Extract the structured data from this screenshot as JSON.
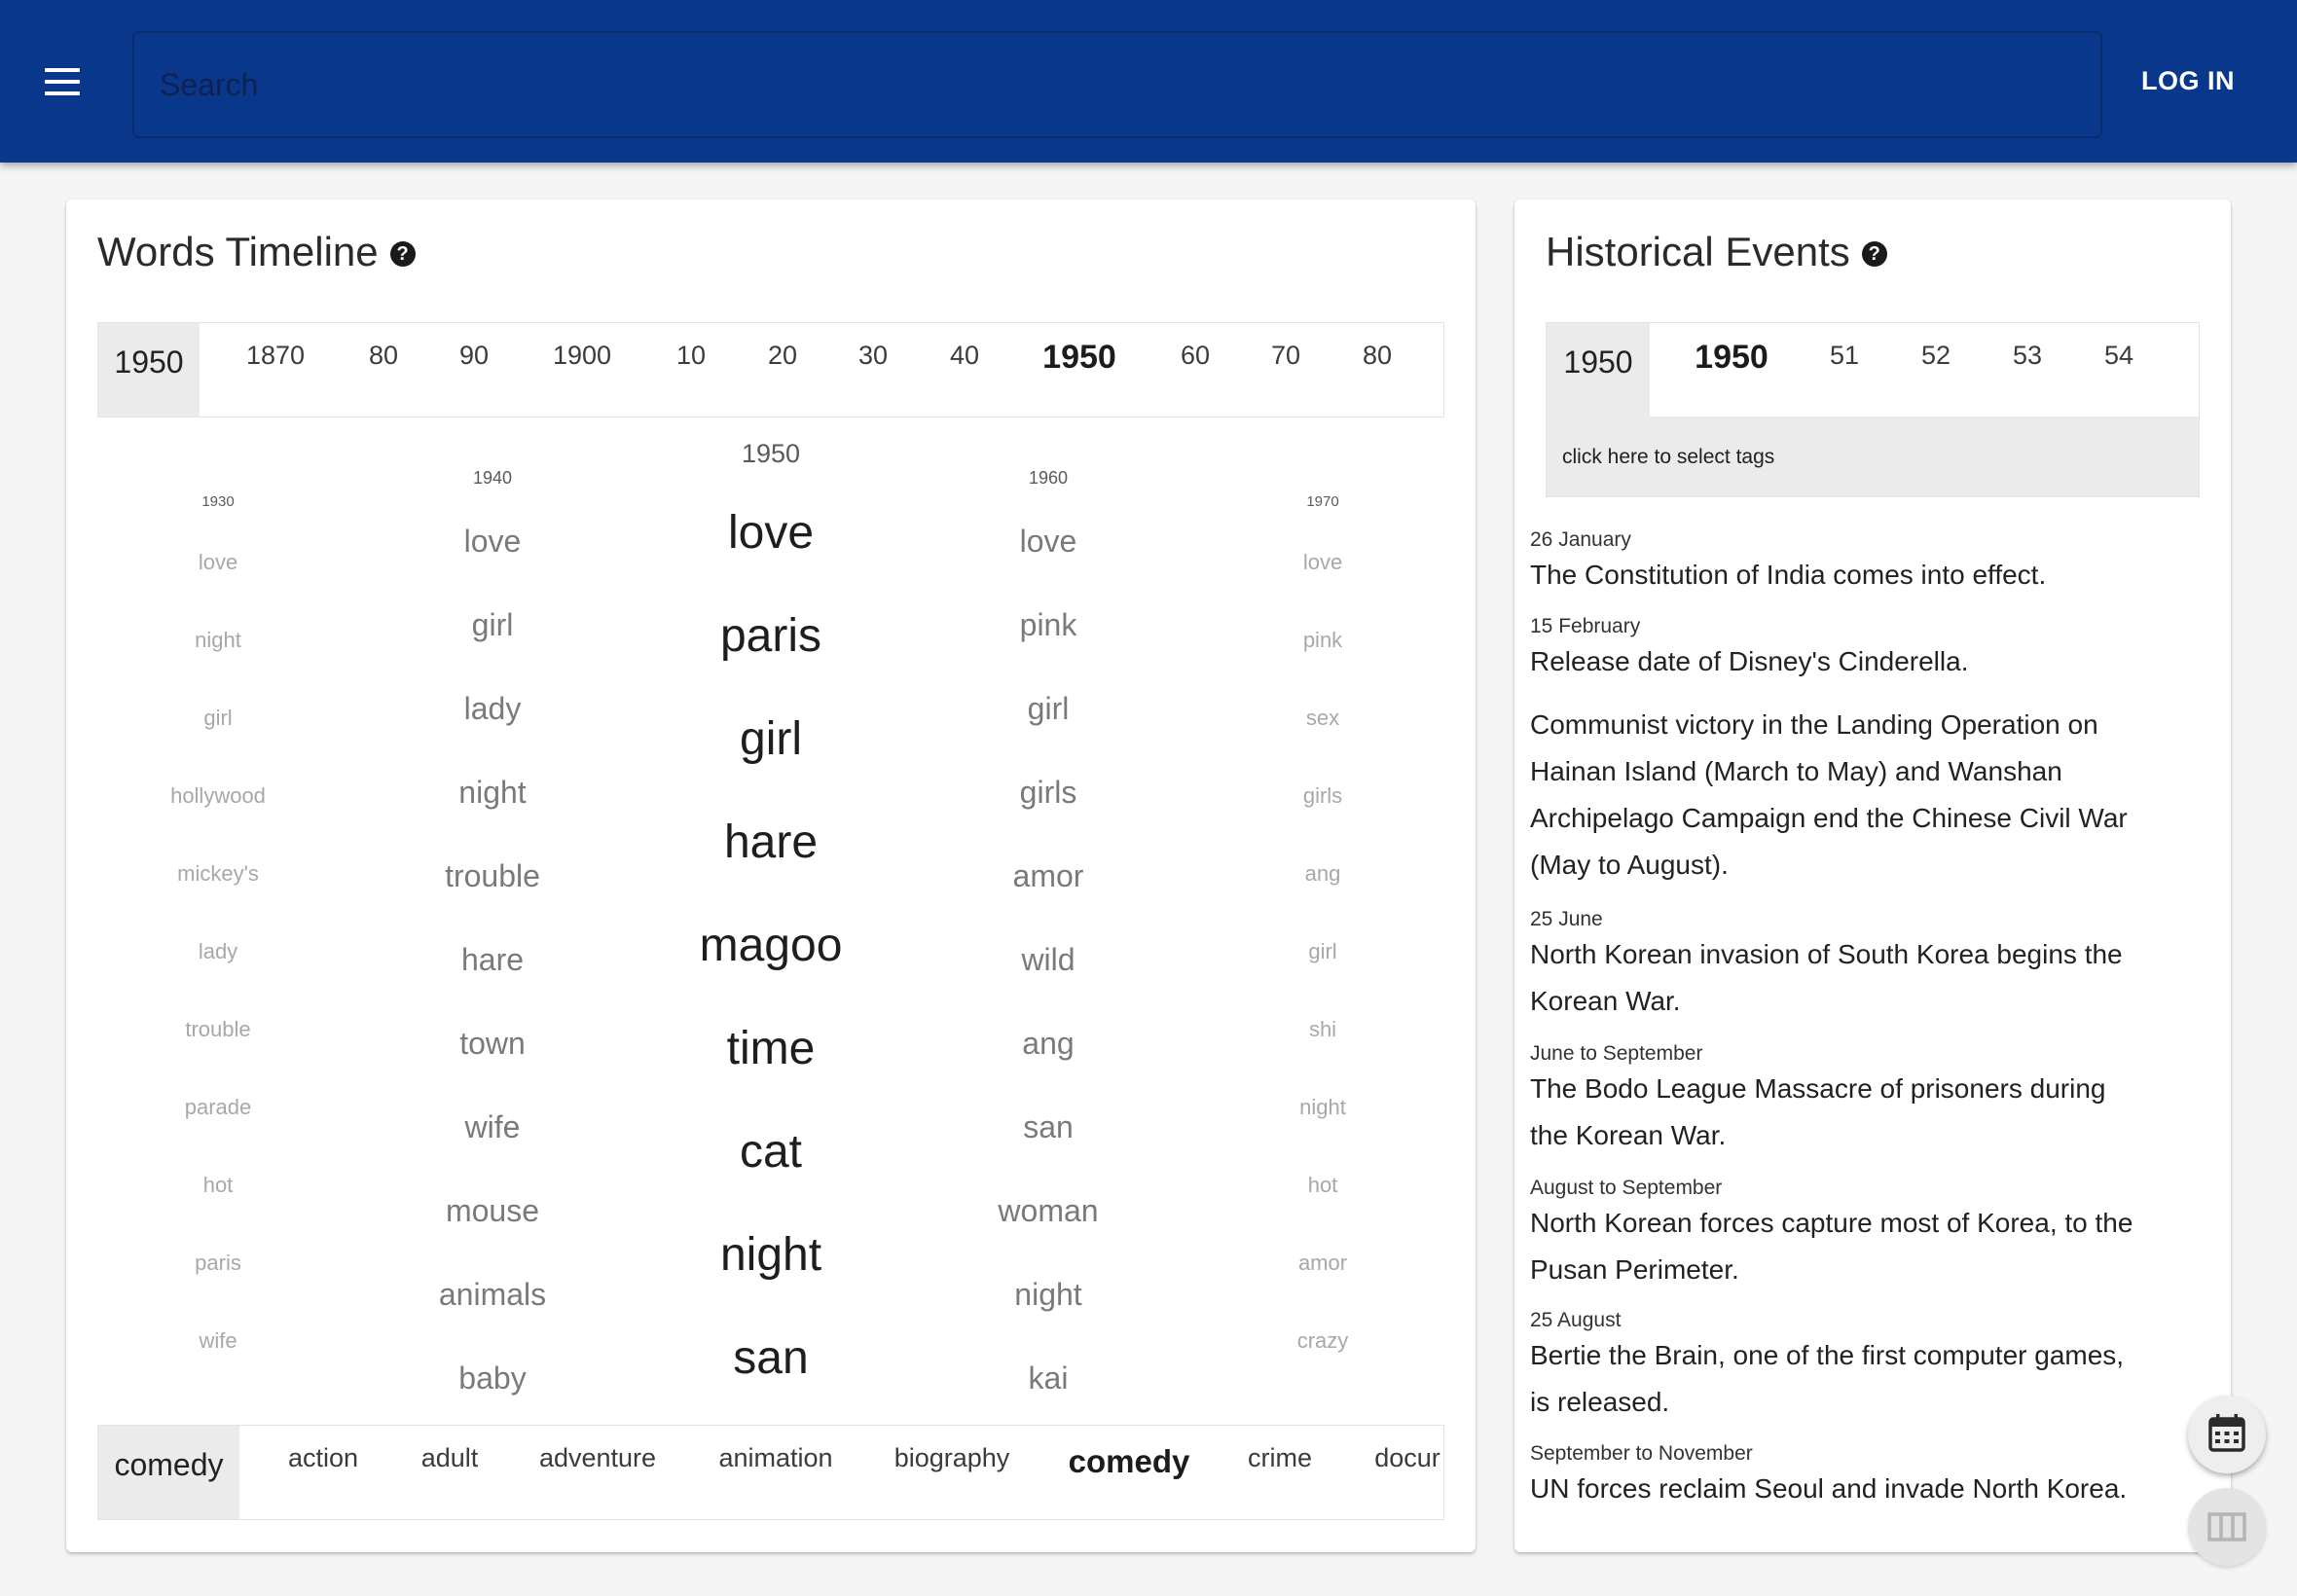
{
  "header": {
    "search_placeholder": "Search",
    "login_label": "LOG IN",
    "menu_icon": "hamburger-menu-icon",
    "bar_color": "#08378c"
  },
  "words_timeline": {
    "title": "Words Timeline",
    "help_icon": "question-circle-icon",
    "decade_selector": {
      "current": "1950",
      "options": [
        "1870",
        "80",
        "90",
        "1900",
        "10",
        "20",
        "30",
        "40",
        "1950",
        "60",
        "70",
        "80"
      ],
      "selected": "1950"
    },
    "columns": [
      {
        "year": "1930",
        "words": [
          "love",
          "night",
          "girl",
          "hollywood",
          "mickey's",
          "lady",
          "trouble",
          "parade",
          "hot",
          "paris",
          "wife"
        ]
      },
      {
        "year": "1940",
        "words": [
          "love",
          "girl",
          "lady",
          "night",
          "trouble",
          "hare",
          "town",
          "wife",
          "mouse",
          "animals",
          "baby"
        ]
      },
      {
        "year": "1950",
        "words": [
          "love",
          "paris",
          "girl",
          "hare",
          "magoo",
          "time",
          "cat",
          "night",
          "san"
        ]
      },
      {
        "year": "1960",
        "words": [
          "love",
          "pink",
          "girl",
          "girls",
          "amor",
          "wild",
          "ang",
          "san",
          "woman",
          "night",
          "kai"
        ]
      },
      {
        "year": "1970",
        "words": [
          "love",
          "pink",
          "sex",
          "girls",
          "ang",
          "girl",
          "shi",
          "night",
          "hot",
          "amor",
          "crazy"
        ]
      }
    ],
    "genre_selector": {
      "current": "comedy",
      "options": [
        "action",
        "adult",
        "adventure",
        "animation",
        "biography",
        "comedy",
        "crime",
        "docur"
      ],
      "selected": "comedy"
    }
  },
  "historical_events": {
    "title": "Historical Events",
    "help_icon": "question-circle-icon",
    "year_selector": {
      "current": "1950",
      "options": [
        "1950",
        "51",
        "52",
        "53",
        "54"
      ],
      "selected": "1950",
      "tags_prompt": "click here to select tags"
    },
    "events": [
      {
        "date": "26 January",
        "lines": [
          "The Constitution of India comes into effect."
        ]
      },
      {
        "date": "15 February",
        "lines": [
          "Release date of Disney's Cinderella."
        ]
      },
      {
        "date": "",
        "lines": [
          "Communist victory in the Landing Operation on",
          "Hainan Island (March to May) and Wanshan",
          "Archipelago Campaign end the Chinese Civil War",
          "(May to August)."
        ]
      },
      {
        "date": "25 June",
        "lines": [
          "North Korean invasion of South Korea begins the",
          "Korean War."
        ]
      },
      {
        "date": "June to September",
        "lines": [
          "The Bodo League Massacre of prisoners during",
          "the Korean War."
        ]
      },
      {
        "date": "August to September",
        "lines": [
          "North Korean forces capture most of Korea, to the",
          "Pusan Perimeter."
        ]
      },
      {
        "date": "25 August",
        "lines": [
          "Bertie the Brain, one of the first computer games,",
          "is released."
        ]
      },
      {
        "date": "September to November",
        "lines": [
          "UN forces reclaim Seoul and invade North Korea."
        ]
      }
    ]
  },
  "floating_buttons": [
    "calendar-icon",
    "columns-icon"
  ]
}
